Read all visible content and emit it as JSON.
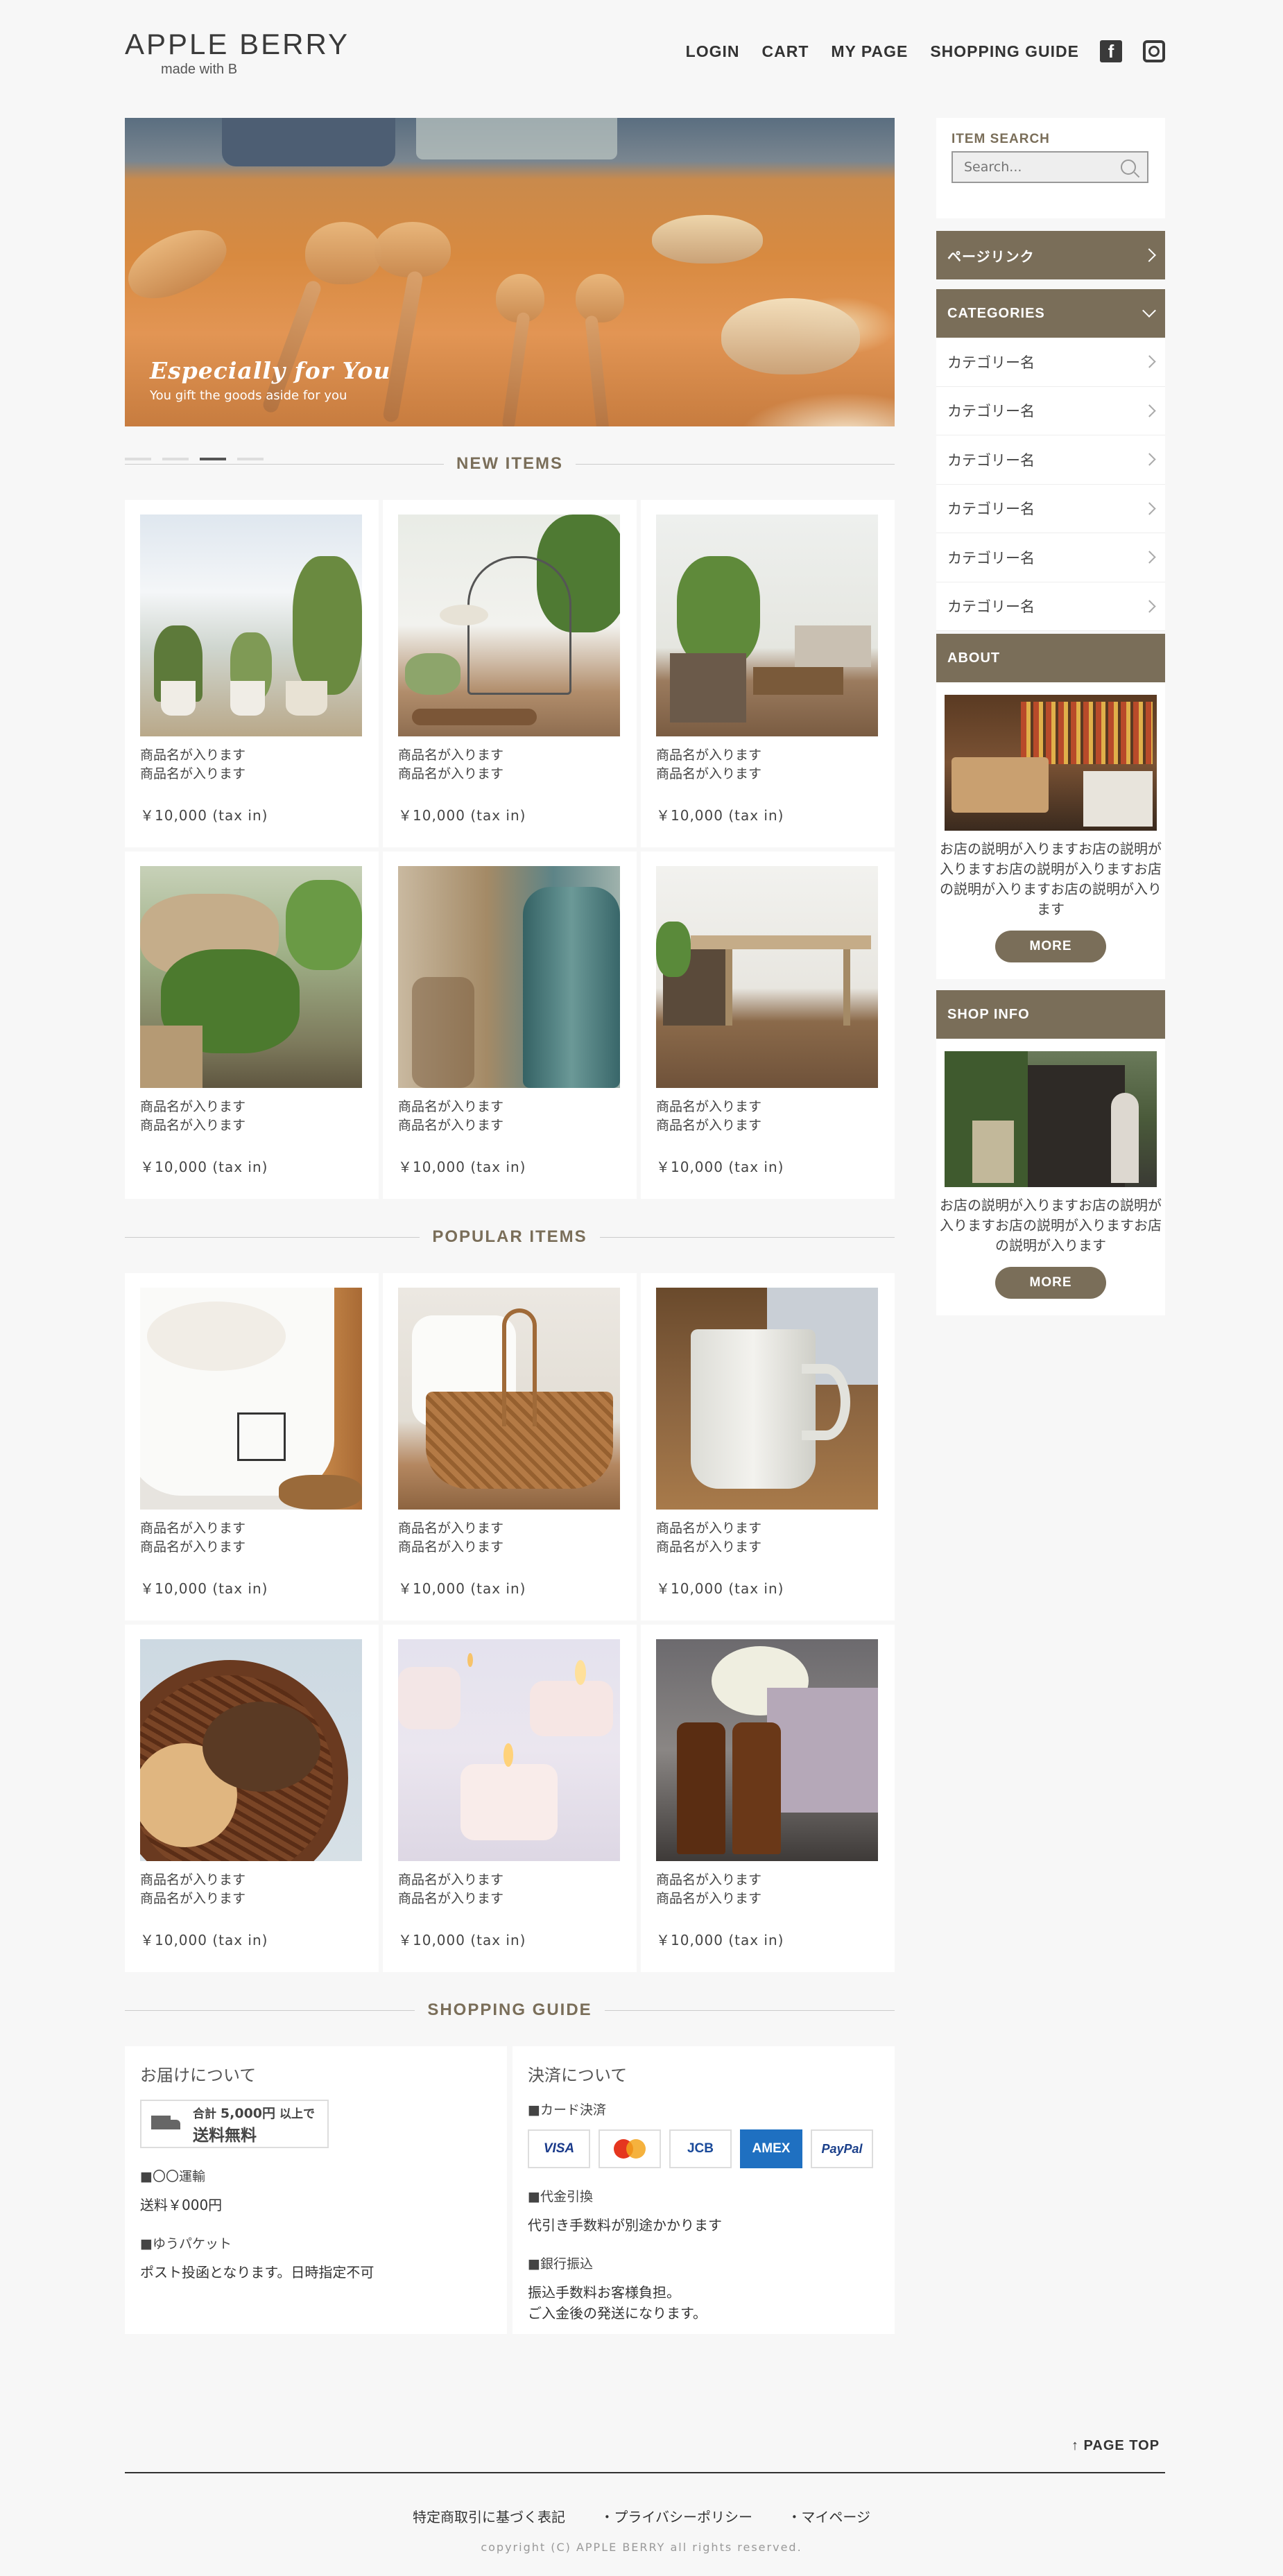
{
  "header": {
    "logo_main": "APPLE BERRY",
    "logo_sub": "made with B",
    "nav": [
      "LOGIN",
      "CART",
      "MY PAGE",
      "SHOPPING GUIDE"
    ],
    "icons": [
      "facebook-icon",
      "instagram-icon"
    ]
  },
  "hero": {
    "title": "Especially for You",
    "subtitle": "You gift the goods aside for you",
    "slides": 4,
    "active_slide": 3
  },
  "sections": {
    "new_items": "NEW ITEMS",
    "popular_items": "POPULAR ITEMS",
    "shopping_guide": "SHOPPING GUIDE"
  },
  "new_items": [
    {
      "name1": "商品名が入ります",
      "name2": "商品名が入ります",
      "price": "￥10,000 (tax in)"
    },
    {
      "name1": "商品名が入ります",
      "name2": "商品名が入ります",
      "price": "￥10,000 (tax in)"
    },
    {
      "name1": "商品名が入ります",
      "name2": "商品名が入ります",
      "price": "￥10,000 (tax in)"
    },
    {
      "name1": "商品名が入ります",
      "name2": "商品名が入ります",
      "price": "￥10,000 (tax in)"
    },
    {
      "name1": "商品名が入ります",
      "name2": "商品名が入ります",
      "price": "￥10,000 (tax in)"
    },
    {
      "name1": "商品名が入ります",
      "name2": "商品名が入ります",
      "price": "￥10,000 (tax in)"
    }
  ],
  "popular_items": [
    {
      "name1": "商品名が入ります",
      "name2": "商品名が入ります",
      "price": "￥10,000 (tax in)"
    },
    {
      "name1": "商品名が入ります",
      "name2": "商品名が入ります",
      "price": "￥10,000 (tax in)"
    },
    {
      "name1": "商品名が入ります",
      "name2": "商品名が入ります",
      "price": "￥10,000 (tax in)"
    },
    {
      "name1": "商品名が入ります",
      "name2": "商品名が入ります",
      "price": "￥10,000 (tax in)"
    },
    {
      "name1": "商品名が入ります",
      "name2": "商品名が入ります",
      "price": "￥10,000 (tax in)"
    },
    {
      "name1": "商品名が入ります",
      "name2": "商品名が入ります",
      "price": "￥10,000 (tax in)"
    }
  ],
  "sidebar": {
    "search_label": "ITEM SEARCH",
    "search_placeholder": "Search...",
    "page_link": "ページリンク",
    "categories_label": "CATEGORIES",
    "categories": [
      "カテゴリー名",
      "カテゴリー名",
      "カテゴリー名",
      "カテゴリー名",
      "カテゴリー名",
      "カテゴリー名"
    ],
    "about_label": "ABOUT",
    "about_text": "お店の説明が入りますお店の説明が入りますお店の説明が入りますお店の説明が入りますお店の説明が入ります",
    "shop_info_label": "SHOP INFO",
    "shop_info_text": "お店の説明が入りますお店の説明が入りますお店の説明が入りますお店の説明が入ります",
    "more": "MORE"
  },
  "guide": {
    "delivery_title": "お届けについて",
    "badge_line1_prefix": "合計",
    "badge_amount": "5,000円",
    "badge_line1_suffix": "以上で",
    "badge_line2": "送料無料",
    "carrier_label": "■〇〇運輸",
    "carrier_text": "送料￥000円",
    "packet_label": "■ゆうパケット",
    "packet_text": "ポスト投函となります。日時指定不可",
    "payment_title": "決済について",
    "card_label": "■カード決済",
    "cards": [
      "VISA",
      "mastercard",
      "JCB",
      "AMEX",
      "PayPal"
    ],
    "cod_label": "■代金引換",
    "cod_text": "代引き手数料が別途かかります",
    "bank_label": "■銀行振込",
    "bank_text1": "振込手数料お客様負担。",
    "bank_text2": "ご入金後の発送になります。"
  },
  "footer": {
    "page_top": "↑ PAGE TOP",
    "links": [
      "特定商取引に基づく表記",
      "・プライバシーポリシー",
      "・マイページ"
    ],
    "copyright": "copyright (C) APPLE BERRY all rights reserved."
  },
  "colors": {
    "accent": "#7a6e59",
    "background": "#f7f7f7"
  }
}
